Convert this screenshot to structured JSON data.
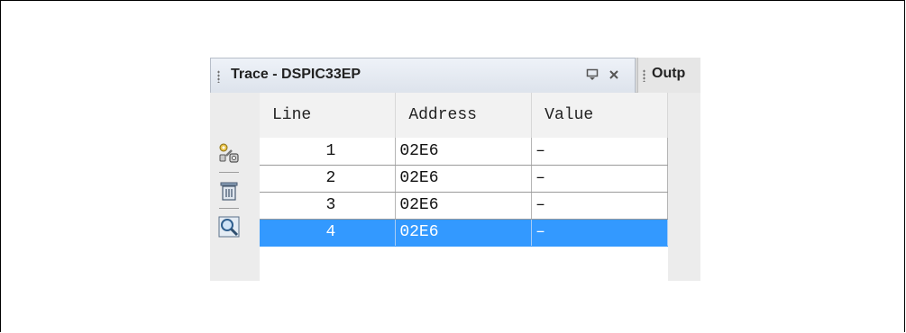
{
  "trace_panel": {
    "tab_title": "Trace - DSPIC33EP",
    "minimize_icon": "minimize-icon",
    "close_icon": "close-icon"
  },
  "output_tab": {
    "title": "Outp"
  },
  "toolbar": {
    "buttons": [
      {
        "name": "settings-icon"
      },
      {
        "name": "trash-icon"
      },
      {
        "name": "zoom-icon"
      }
    ]
  },
  "table": {
    "columns": [
      "Line",
      "Address",
      "Value"
    ],
    "rows": [
      {
        "line": "1",
        "address": "02E6",
        "value": "–"
      },
      {
        "line": "2",
        "address": "02E6",
        "value": "–"
      },
      {
        "line": "3",
        "address": "02E6",
        "value": "–"
      },
      {
        "line": "4",
        "address": "02E6",
        "value": "–",
        "selected": true
      }
    ]
  },
  "colors": {
    "selection": "#3399ff",
    "tab_active": "#dde3ec",
    "panel_bg": "#ececec"
  }
}
